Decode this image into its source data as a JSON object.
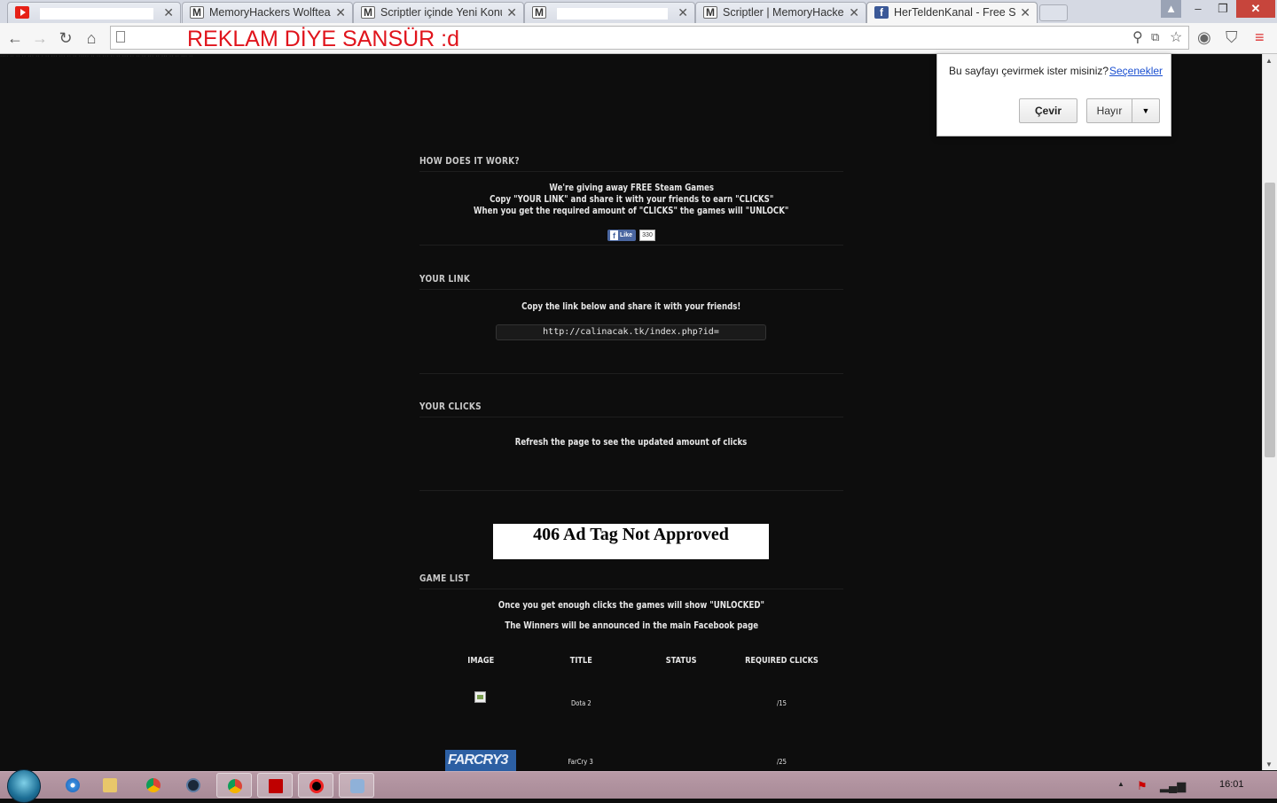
{
  "browser": {
    "tabs": [
      {
        "title": "",
        "favicon": "youtube-icon",
        "redacted": true,
        "active": false
      },
      {
        "title": "MemoryHackers Wolfteam",
        "favicon": "m-site-icon",
        "redacted": false,
        "active": false
      },
      {
        "title": "Scriptler içinde Yeni Konu",
        "favicon": "m-site-icon",
        "redacted": false,
        "active": false
      },
      {
        "title": "",
        "favicon": "m-site-icon",
        "redacted": true,
        "active": false
      },
      {
        "title": "Scriptler | MemoryHackers",
        "favicon": "m-site-icon",
        "redacted": false,
        "active": false
      },
      {
        "title": "HerTeldenKanal - Free Ste",
        "favicon": "facebook-icon",
        "redacted": false,
        "active": true
      }
    ],
    "window_buttons": {
      "minimize": "–",
      "maximize": "❐",
      "close": "✕"
    },
    "url_text": "REKLAM DİYE SANSÜR :d",
    "url_color": "#e0141c"
  },
  "translate_bar": {
    "question": "Bu sayfayı çevirmek ister misiniz?",
    "options_link": "Seçenekler",
    "translate_button": "Çevir",
    "no_button": "Hayır"
  },
  "page": {
    "top_strip_text": "···· ·· ·· ·· ··· ·· · ·· ··· ··· ·· ·· ····· ·· ·· ··· ·· ·· ··· ·· ·· ·· ··· ·· ··· ·· ·· ··· ··",
    "how": {
      "title": "HOW DOES IT WORK?",
      "line1": "We're giving away FREE Steam Games",
      "line2": "Copy \"YOUR LINK\" and share it with your friends to earn \"CLICKS\"",
      "line3": "When you get the required amount of \"CLICKS\" the games will \"UNLOCK\"",
      "like_label": "Like",
      "like_count": "330"
    },
    "link": {
      "title": "YOUR LINK",
      "instruction": "Copy the link below and share it with your friends!",
      "url": "http://calinacak.tk/index.php?id="
    },
    "clicks": {
      "title": "YOUR CLICKS",
      "text": "Refresh the page to see the updated amount of clicks"
    },
    "ad_text": "406 Ad Tag Not Approved",
    "games": {
      "title": "GAME LIST",
      "line1": "Once you get enough clicks the games will show \"UNLOCKED\"",
      "line2": "The Winners will be announced in the main Facebook page",
      "headers": [
        "IMAGE",
        "TITLE",
        "STATUS",
        "REQUIRED CLICKS"
      ],
      "rows": [
        {
          "title": "Dota 2",
          "status": "",
          "required": "/15",
          "image": "broken-image-icon"
        },
        {
          "title": "FarCry 3",
          "status": "",
          "required": "/25",
          "image": "farcry3-logo",
          "image_text": "FARCRY3"
        }
      ]
    }
  },
  "taskbar": {
    "apps": [
      "internet-explorer",
      "file-explorer",
      "chrome",
      "steam",
      "chrome",
      "filezilla",
      "screen-recorder",
      "tool"
    ],
    "clock": "16:01"
  }
}
